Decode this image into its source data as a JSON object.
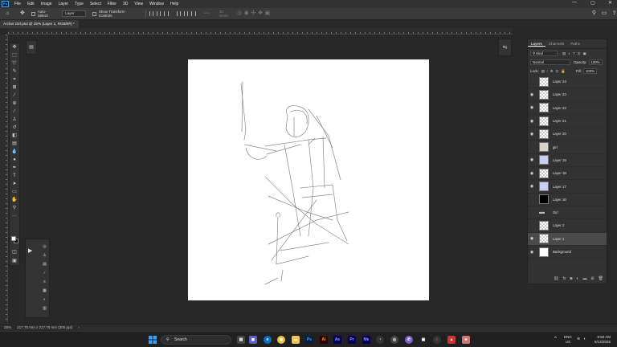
{
  "menu": {
    "logo": "Ps",
    "items": [
      "File",
      "Edit",
      "Image",
      "Layer",
      "Type",
      "Select",
      "Filter",
      "3D",
      "View",
      "Window",
      "Help"
    ]
  },
  "options": {
    "auto_select_label": "Auto-Select:",
    "auto_select_value": "Layer",
    "transform_label": "Show Transform Controls",
    "mode_label": "3D Mode:"
  },
  "document": {
    "tab_title": "Archer Girl.psd @ 25% (Layer 1, RGB/8#) *"
  },
  "layers_panel": {
    "tabs": [
      "Layers",
      "Channels",
      "Paths"
    ],
    "filter_kind": "Kind",
    "blend_mode": "Normal",
    "opacity_label": "Opacity:",
    "opacity_value": "100%",
    "lock_label": "Lock:",
    "fill_label": "Fill:",
    "fill_value": "100%",
    "layers": [
      {
        "name": "Layer 24",
        "visible": false,
        "selected": false,
        "thumb": "transparent"
      },
      {
        "name": "Layer 23",
        "visible": true,
        "selected": false,
        "thumb": "transparent"
      },
      {
        "name": "Layer 22",
        "visible": true,
        "selected": false,
        "thumb": "transparent"
      },
      {
        "name": "Layer 21",
        "visible": true,
        "selected": false,
        "thumb": "transparent"
      },
      {
        "name": "Layer 20",
        "visible": true,
        "selected": false,
        "thumb": "transparent"
      },
      {
        "name": "girl",
        "visible": false,
        "selected": false,
        "thumb": "figure"
      },
      {
        "name": "Layer 19",
        "visible": true,
        "selected": false,
        "thumb": "blue"
      },
      {
        "name": "Layer 18",
        "visible": true,
        "selected": false,
        "thumb": "transparent"
      },
      {
        "name": "Layer 17",
        "visible": true,
        "selected": false,
        "thumb": "blue"
      },
      {
        "name": "Layer 16",
        "visible": false,
        "selected": false,
        "thumb": "black"
      },
      {
        "name": "Girl",
        "visible": false,
        "selected": false,
        "thumb": "folder"
      },
      {
        "name": "Layer 2",
        "visible": false,
        "selected": false,
        "thumb": "transparent"
      },
      {
        "name": "Layer 1",
        "visible": true,
        "selected": true,
        "thumb": "transparent"
      },
      {
        "name": "Background",
        "visible": true,
        "selected": false,
        "thumb": "white"
      }
    ]
  },
  "status": {
    "zoom": "25%",
    "doc_size": "217.75 mm x 217.75 mm (300 ppi)"
  },
  "taskbar": {
    "search_placeholder": "Search",
    "language": "ENG",
    "region": "US",
    "time": "8:50 AM",
    "date": "6/14/2025"
  }
}
